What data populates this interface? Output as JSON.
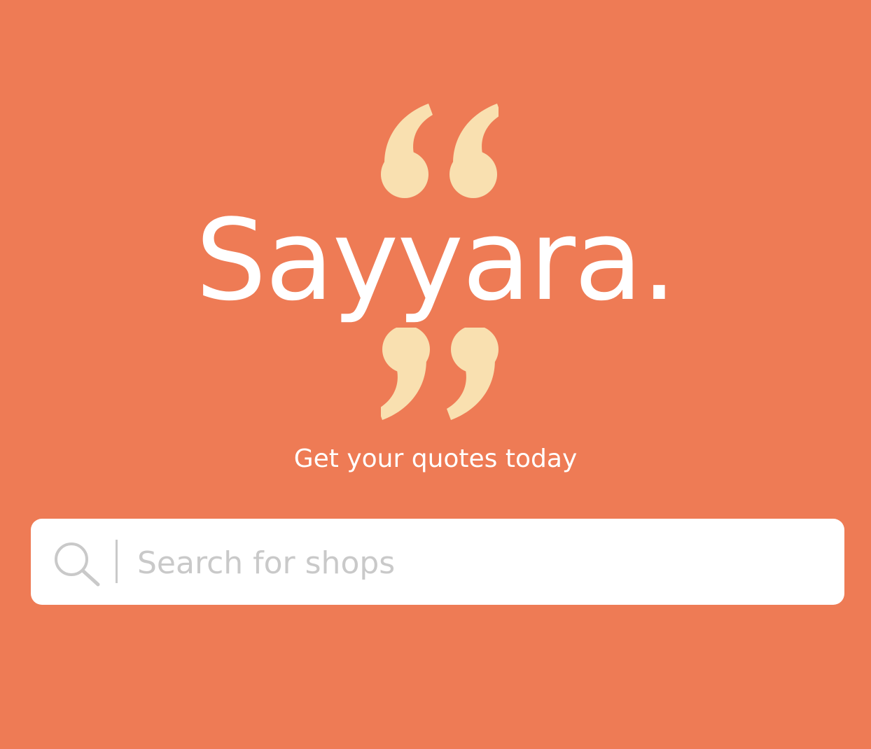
{
  "theme": {
    "background": "#EE7B55",
    "accent": "#F9E0B0",
    "text": "#FFFFFF",
    "search_background": "#FFFFFF",
    "search_muted": "#C9C9C9"
  },
  "hero": {
    "brand": "Sayyara.",
    "tagline": "Get your quotes today",
    "open_quote_icon": "left-double-quote-icon",
    "close_quote_icon": "right-double-quote-icon"
  },
  "search": {
    "placeholder": "Search for shops",
    "value": "",
    "icon": "search-icon"
  }
}
